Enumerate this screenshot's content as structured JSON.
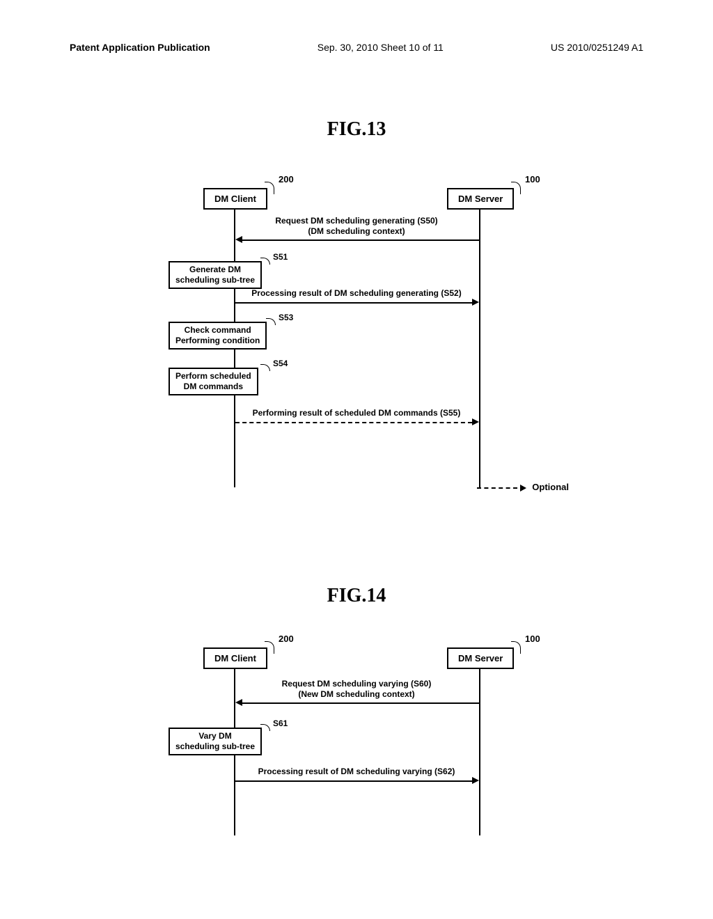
{
  "header": {
    "left": "Patent Application Publication",
    "center": "Sep. 30, 2010  Sheet 10 of 11",
    "right": "US 2010/0251249 A1"
  },
  "fig13": {
    "title": "FIG.13",
    "client_label": "DM Client",
    "server_label": "DM Server",
    "client_ref": "200",
    "server_ref": "100",
    "msg_s50_line1": "Request DM scheduling generating (S50)",
    "msg_s50_line2": "(DM scheduling context)",
    "s51_label": "S51",
    "s51_box_line1": "Generate DM",
    "s51_box_line2": "scheduling sub-tree",
    "msg_s52": "Processing result of DM scheduling generating (S52)",
    "s53_label": "S53",
    "s53_box_line1": "Check command",
    "s53_box_line2": "Performing condition",
    "s54_label": "S54",
    "s54_box_line1": "Perform scheduled",
    "s54_box_line2": "DM commands",
    "msg_s55": "Performing result of scheduled DM commands (S55)",
    "legend": "Optional"
  },
  "fig14": {
    "title": "FIG.14",
    "client_label": "DM Client",
    "server_label": "DM Server",
    "client_ref": "200",
    "server_ref": "100",
    "msg_s60_line1": "Request DM scheduling varying (S60)",
    "msg_s60_line2": "(New DM scheduling context)",
    "s61_label": "S61",
    "s61_box_line1": "Vary DM",
    "s61_box_line2": "scheduling sub-tree",
    "msg_s62": "Processing result of DM scheduling varying (S62)"
  }
}
